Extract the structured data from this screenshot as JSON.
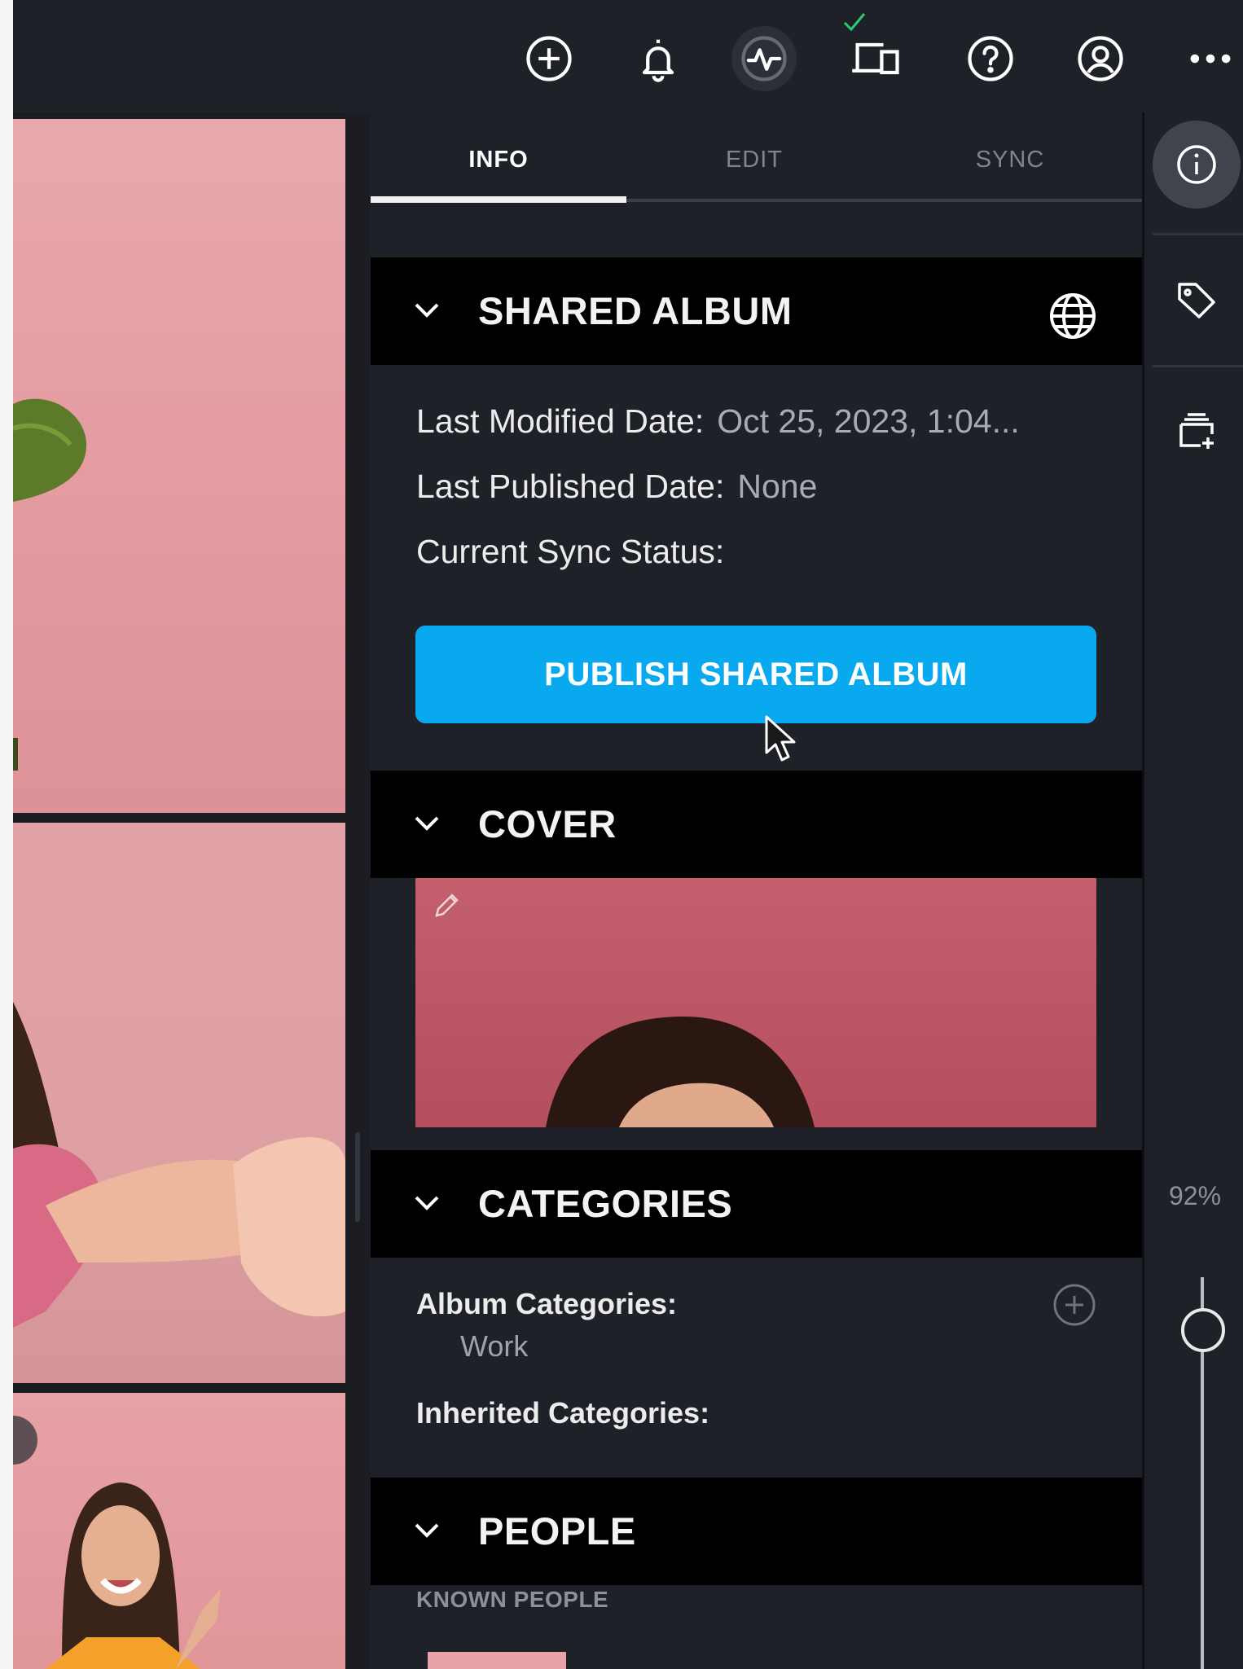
{
  "tabs": {
    "info": "INFO",
    "edit": "EDIT",
    "sync": "SYNC"
  },
  "shared_album": {
    "title": "SHARED ALBUM",
    "last_modified_label": "Last Modified Date:",
    "last_modified_value": "Oct 25, 2023, 1:04...",
    "last_published_label": "Last Published Date:",
    "last_published_value": "None",
    "sync_status_label": "Current Sync Status:",
    "publish_button": "PUBLISH SHARED ALBUM"
  },
  "cover": {
    "title": "COVER"
  },
  "categories": {
    "title": "CATEGORIES",
    "album_label": "Album Categories:",
    "album_values": [
      "Work"
    ],
    "inherited_label": "Inherited Categories:"
  },
  "people": {
    "title": "PEOPLE",
    "known_label": "KNOWN PEOPLE"
  },
  "zoom": "92%",
  "zoom_level": 0.92,
  "colors": {
    "accent": "#08a9ee",
    "panel_bg": "#1e2127",
    "header_bg": "#000000",
    "sync_ok": "#2ecc71"
  }
}
